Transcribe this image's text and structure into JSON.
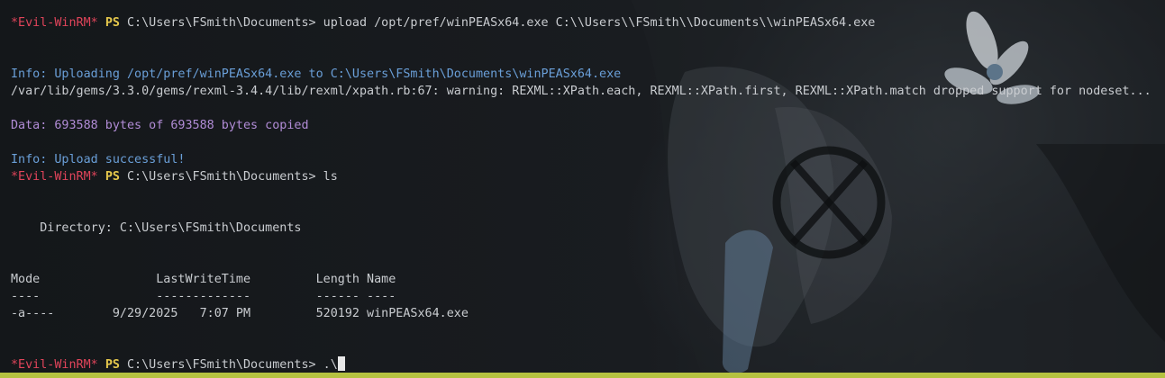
{
  "prompt": {
    "name": "*Evil-WinRM*",
    "ps": "PS",
    "path": "C:\\Users\\FSmith\\Documents>"
  },
  "commands": {
    "upload": " upload /opt/pref/winPEASx64.exe C:\\\\Users\\\\FSmith\\\\Documents\\\\winPEASx64.exe",
    "ls": " ls",
    "current": " .\\"
  },
  "output": {
    "uploading": "Info: Uploading /opt/pref/winPEASx64.exe to C:\\Users\\FSmith\\Documents\\winPEASx64.exe",
    "warning": "/var/lib/gems/3.3.0/gems/rexml-3.4.4/lib/rexml/xpath.rb:67: warning: REXML::XPath.each, REXML::XPath.first, REXML::XPath.match dropped support for nodeset...",
    "data_copied": "Data: 693588 bytes of 693588 bytes copied",
    "upload_success": "Info: Upload successful!",
    "directory": "    Directory: C:\\Users\\FSmith\\Documents",
    "table_header": "Mode                LastWriteTime         Length Name",
    "table_rule": "----                -------------         ------ ----",
    "table_row": "-a----        9/29/2025   7:07 PM         520192 winPEASx64.exe"
  },
  "colors": {
    "prompt_name": "#e0445a",
    "prompt_ps": "#e6c84c",
    "info": "#6a9fd8",
    "data": "#b18cd6",
    "status_bar": "#b5c240"
  }
}
